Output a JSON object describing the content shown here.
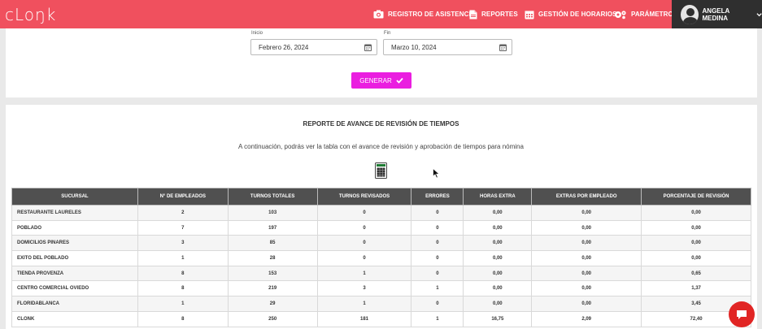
{
  "brand": {
    "logo_text": "cLoŋk"
  },
  "nav": {
    "items": [
      {
        "label": "REGISTRO DE ASISTENCIA",
        "icon": "camera-icon"
      },
      {
        "label": "REPORTES",
        "icon": "document-icon"
      },
      {
        "label": "GESTIÓN DE HORARIOS",
        "icon": "calendar-icon"
      },
      {
        "label": "PARÁMETROS",
        "icon": "gear-icon"
      }
    ],
    "user_name": "ANGELA MEDINA"
  },
  "filters": {
    "start_label": "Inicio",
    "start_value": "Febrero 26, 2024",
    "end_label": "Fin",
    "end_value": "Marzo 10, 2024",
    "generate_label": "GENERAR"
  },
  "report": {
    "title": "REPORTE DE AVANCE DE REVISIÓN DE TIEMPOS",
    "subtitle": "A continuación, podrás ver la tabla con el avance de revisión y aprobación de tiempos para nómina",
    "columns": [
      "SUCURSAL",
      "N° DE EMPLEADOS",
      "TURNOS TOTALES",
      "TURNOS REVISADOS",
      "ERRORES",
      "HORAS EXTRA",
      "EXTRAS POR EMPLEADO",
      "PORCENTAJE DE REVISIÓN"
    ],
    "rows": [
      [
        "RESTAURANTE LAURELES",
        "2",
        "103",
        "0",
        "0",
        "0,00",
        "0,00",
        "0,00"
      ],
      [
        "POBLADO",
        "7",
        "197",
        "0",
        "0",
        "0,00",
        "0,00",
        "0,00"
      ],
      [
        "DOMICILIOS PINARES",
        "3",
        "85",
        "0",
        "0",
        "0,00",
        "0,00",
        "0,00"
      ],
      [
        "EXITO DEL POBLADO",
        "1",
        "28",
        "0",
        "0",
        "0,00",
        "0,00",
        "0,00"
      ],
      [
        "TIENDA PROVENZA",
        "8",
        "153",
        "1",
        "0",
        "0,00",
        "0,00",
        "0,65"
      ],
      [
        "CENTRO COMERCIAL OVIEDO",
        "8",
        "219",
        "3",
        "1",
        "0,00",
        "0,00",
        "1,37"
      ],
      [
        "FLORIDABLANCA",
        "1",
        "29",
        "1",
        "0",
        "0,00",
        "0,00",
        "3,45"
      ],
      [
        "CLONK",
        "8",
        "250",
        "181",
        "1",
        "16,75",
        "2,09",
        "72,40"
      ]
    ]
  },
  "colors": {
    "topbar": "#f0505e",
    "user_panel": "#2f2f2f",
    "generate_button": "#ea1ee0",
    "table_header": "#505050",
    "chat_button": "#e12524"
  }
}
